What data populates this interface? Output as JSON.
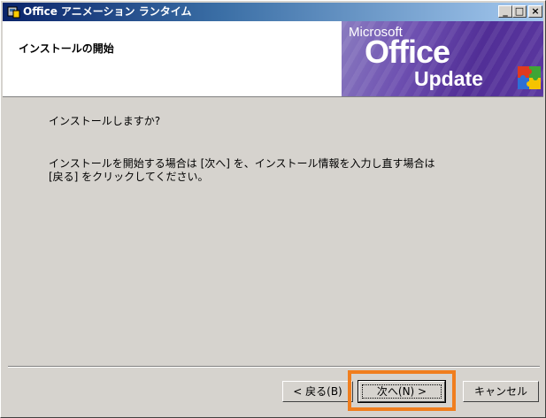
{
  "window": {
    "title": "Office アニメーション ランタイム",
    "controls": {
      "minimize": "_",
      "maximize": "□",
      "close": "×"
    }
  },
  "header": {
    "title": "インストールの開始",
    "banner": {
      "line1": "Microsoft",
      "line2": "Office",
      "line3": "Update",
      "icon": "puzzle-icon"
    }
  },
  "content": {
    "question": "インストールしますか?",
    "description_lines": [
      "インストールを開始する場合は [次へ] を、インストール情報を入力し直す場合は",
      "[戻る] をクリックしてください。"
    ]
  },
  "buttons": {
    "back": "< 戻る(B)",
    "next": "次へ(N) >",
    "cancel": "キャンセル"
  },
  "colors": {
    "highlight": "#f07e1e",
    "titlebar_start": "#0a246a",
    "banner": "#512e96"
  }
}
